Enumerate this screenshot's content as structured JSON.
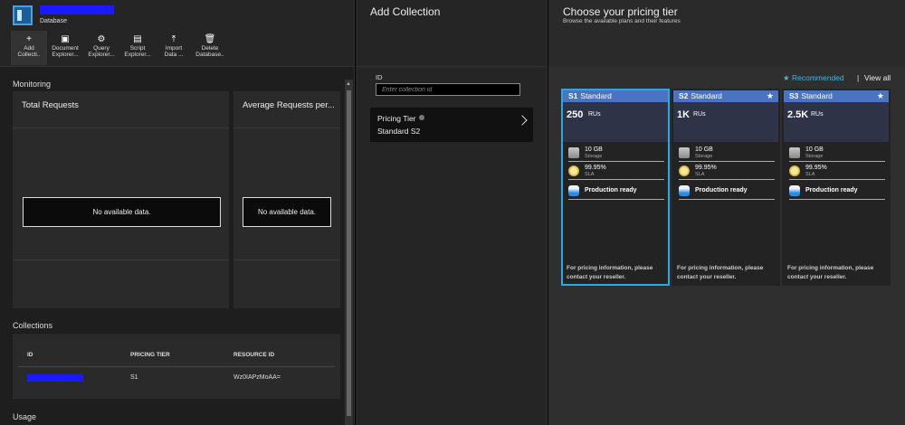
{
  "db_blade": {
    "subtitle": "Database",
    "toolbar": [
      {
        "icon": "+",
        "label1": "Add",
        "label2": "Collecti.."
      },
      {
        "icon": "▣",
        "label1": "Document",
        "label2": "Explorer..."
      },
      {
        "icon": "⚙",
        "label1": "Query",
        "label2": "Explorer..."
      },
      {
        "icon": "▤",
        "label1": "Script",
        "label2": "Explorer..."
      },
      {
        "icon": "⤒",
        "label1": "Import",
        "label2": "Data ..."
      },
      {
        "icon": "🗑",
        "label1": "Delete",
        "label2": "Database.."
      }
    ],
    "monitoring_title": "Monitoring",
    "total_requests_title": "Total Requests",
    "avg_requests_title": "Average Requests per...",
    "no_data": "No available data.",
    "collections_title": "Collections",
    "table": {
      "headers": [
        "ID",
        "PRICING TIER",
        "RESOURCE ID"
      ],
      "rows": [
        {
          "pricing_tier": "S1",
          "resource_id": "Wz0IAPzMoAA="
        }
      ]
    },
    "usage_title": "Usage"
  },
  "add_blade": {
    "title": "Add Collection",
    "id_label": "ID",
    "id_placeholder": "Enter collection id",
    "pricing_tier_label": "Pricing Tier",
    "pricing_tier_value": "Standard S2"
  },
  "pricing_blade": {
    "title": "Choose your pricing tier",
    "subtitle": "Browse the available plans and their features",
    "recommended": "Recommended",
    "separator": "|",
    "view_all": "View all",
    "accent_color": "#2aa8e0",
    "cards": [
      {
        "code": "S1",
        "name": "Standard",
        "ru": "250",
        "ru_unit": "RUs",
        "storage": "10 GB",
        "storage_label": "Storage",
        "sla": "99.95%",
        "sla_label": "SLA",
        "prod": "Production ready",
        "foot": "For pricing information, please contact your reseller.",
        "selected": true,
        "recommended": false
      },
      {
        "code": "S2",
        "name": "Standard",
        "ru": "1K",
        "ru_unit": "RUs",
        "storage": "10 GB",
        "storage_label": "Storage",
        "sla": "99.95%",
        "sla_label": "SLA",
        "prod": "Production ready",
        "foot": "For pricing information, please contact your reseller.",
        "selected": false,
        "recommended": true
      },
      {
        "code": "S3",
        "name": "Standard",
        "ru": "2.5K",
        "ru_unit": "RUs",
        "storage": "10 GB",
        "storage_label": "Storage",
        "sla": "99.95%",
        "sla_label": "SLA",
        "prod": "Production ready",
        "foot": "For pricing information, please contact your reseller.",
        "selected": false,
        "recommended": true
      }
    ]
  }
}
